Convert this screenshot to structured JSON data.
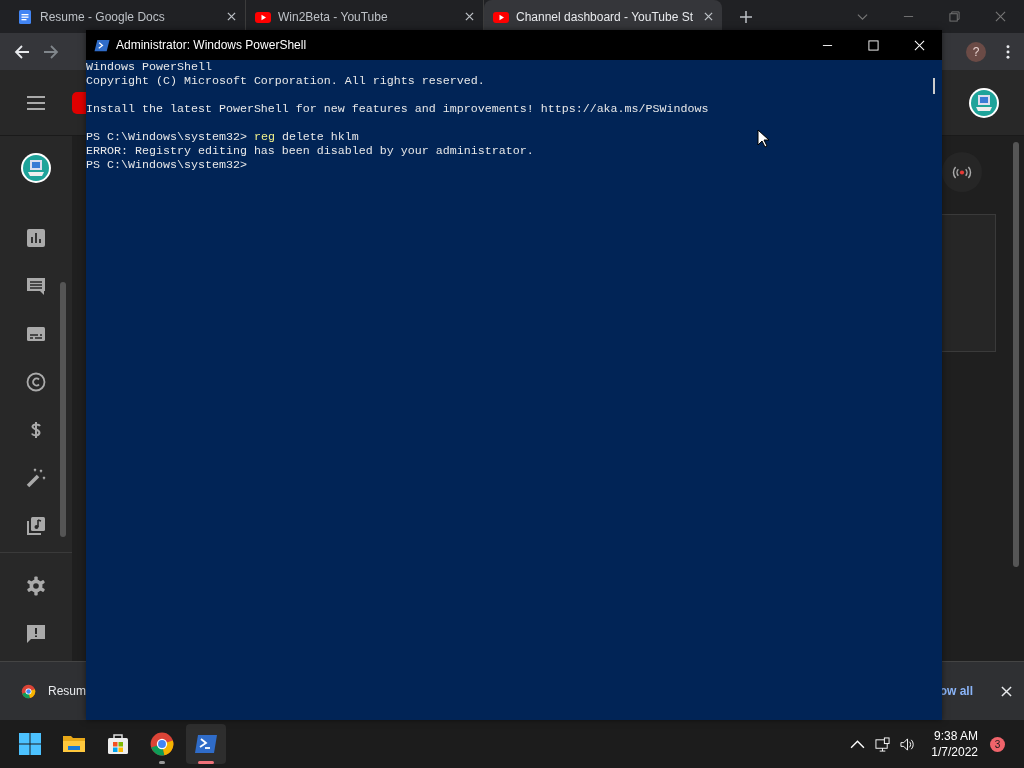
{
  "browser": {
    "tabs": [
      {
        "title": "Resume - Google Docs",
        "kind": "document",
        "selected": false
      },
      {
        "title": "Win2Beta - YouTube",
        "kind": "video",
        "selected": false
      },
      {
        "title": "Channel dashboard - YouTube St",
        "kind": "video",
        "selected": true
      }
    ],
    "profile_initial": "?"
  },
  "download_bar": {
    "file": "Resum",
    "show_all": "ow all"
  },
  "powershell": {
    "title": "Administrator: Windows PowerShell",
    "blocks": [
      [
        {
          "text": "Windows PowerShell"
        },
        {
          "text": "Copyright (C) Microsoft Corporation. All rights reserved."
        }
      ],
      [
        {
          "text": "Install the latest PowerShell for new features and improvements! https://aka.ms/PSWindows"
        }
      ],
      [
        {
          "prompt": "PS C:\\Windows\\system32> ",
          "command": "reg",
          "args": " delete hklm"
        },
        {
          "text": "ERROR: Registry editing has been disabled by your administrator."
        },
        {
          "prompt": "PS C:\\Windows\\system32>"
        }
      ]
    ]
  },
  "taskbar": {
    "apps": [
      {
        "kind": "start",
        "running": false,
        "selected": false
      },
      {
        "kind": "explorer",
        "running": false,
        "selected": false
      },
      {
        "kind": "store",
        "running": false,
        "selected": false
      },
      {
        "kind": "chrome",
        "running": true,
        "selected": false
      },
      {
        "kind": "powershell",
        "running": true,
        "selected": true
      }
    ],
    "time": "9:38 AM",
    "date": "1/7/2022",
    "notifications": "3"
  }
}
